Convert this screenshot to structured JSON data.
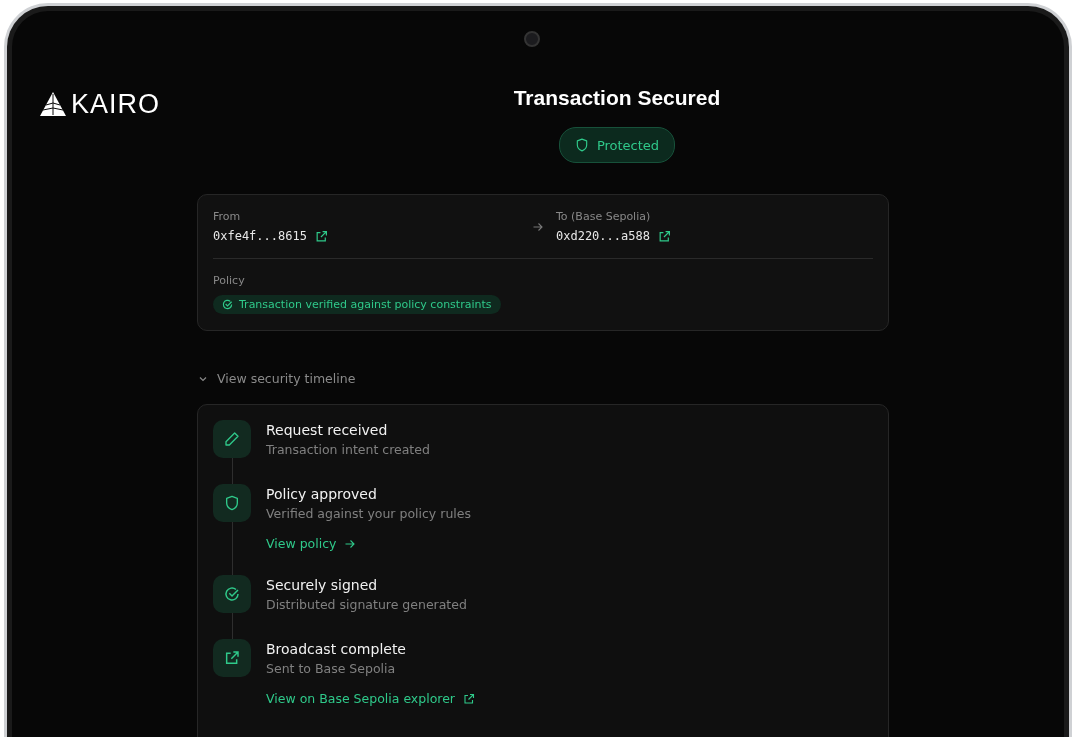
{
  "brand": {
    "name": "KAIRO"
  },
  "header": {
    "title": "Transaction Secured",
    "status": "Protected"
  },
  "transfer": {
    "from": {
      "label": "From",
      "address": "0xfe4f...8615"
    },
    "to": {
      "label": "To (Base Sepolia)",
      "address": "0xd220...a588"
    },
    "policy": {
      "label": "Policy",
      "badge": "Transaction verified against policy constraints"
    }
  },
  "timeline_toggle": {
    "label": "View security timeline",
    "expanded": true
  },
  "timeline": [
    {
      "kind": "request",
      "title": "Request received",
      "subtitle": "Transaction intent created"
    },
    {
      "kind": "policy",
      "title": "Policy approved",
      "subtitle": "Verified against your policy rules",
      "link": "View policy"
    },
    {
      "kind": "signed",
      "title": "Securely signed",
      "subtitle": "Distributed signature generated"
    },
    {
      "kind": "broadcast",
      "title": "Broadcast complete",
      "subtitle": "Sent to Base Sepolia",
      "link": "View on Base Sepolia explorer"
    }
  ]
}
